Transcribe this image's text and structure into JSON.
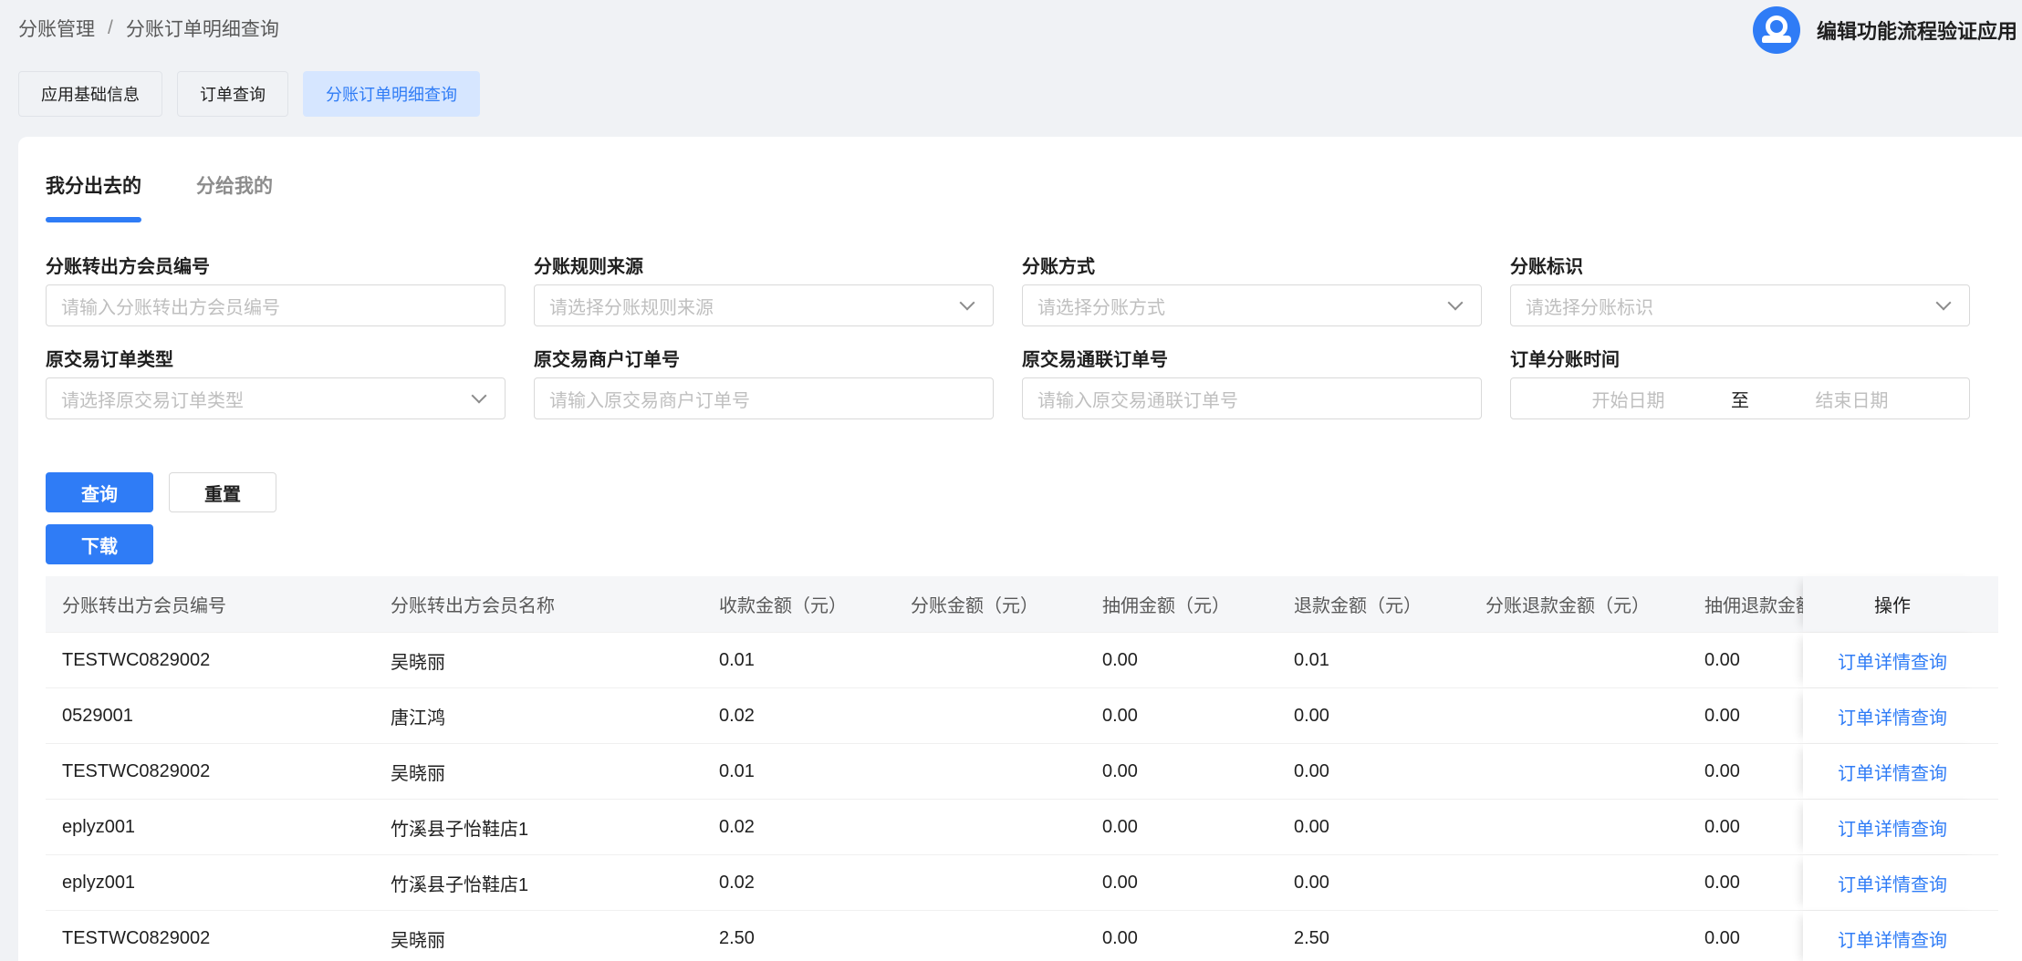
{
  "breadcrumb": {
    "root": "分账管理",
    "separator": "/",
    "current": "分账订单明细查询"
  },
  "user": {
    "name": "编辑功能流程验证应用"
  },
  "top_tabs": [
    {
      "label": "应用基础信息"
    },
    {
      "label": "订单查询"
    },
    {
      "label": "分账订单明细查询"
    }
  ],
  "sub_tabs": [
    {
      "label": "我分出去的"
    },
    {
      "label": "分给我的"
    }
  ],
  "filters": {
    "member_no": {
      "label": "分账转出方会员编号",
      "placeholder": "请输入分账转出方会员编号"
    },
    "rule_source": {
      "label": "分账规则来源",
      "placeholder": "请选择分账规则来源"
    },
    "method": {
      "label": "分账方式",
      "placeholder": "请选择分账方式"
    },
    "flag": {
      "label": "分账标识",
      "placeholder": "请选择分账标识"
    },
    "order_type": {
      "label": "原交易订单类型",
      "placeholder": "请选择原交易订单类型"
    },
    "merchant_order": {
      "label": "原交易商户订单号",
      "placeholder": "请输入原交易商户订单号"
    },
    "union_order": {
      "label": "原交易通联订单号",
      "placeholder": "请输入原交易通联订单号"
    },
    "time": {
      "label": "订单分账时间",
      "start_placeholder": "开始日期",
      "to": "至",
      "end_placeholder": "结束日期"
    }
  },
  "buttons": {
    "query": "查询",
    "reset": "重置",
    "download": "下载"
  },
  "table": {
    "headers": [
      "分账转出方会员编号",
      "分账转出方会员名称",
      "收款金额（元）",
      "分账金额（元）",
      "抽佣金额（元）",
      "退款金额（元）",
      "分账退款金额（元）",
      "抽佣退款金额",
      "操作"
    ],
    "rows": [
      {
        "member_no": "TESTWC0829002",
        "member_name": "吴晓丽",
        "receive": "0.01",
        "split": "",
        "commission": "0.00",
        "refund": "0.01",
        "split_refund": "",
        "commission_refund": "0.00",
        "action": "订单详情查询"
      },
      {
        "member_no": "0529001",
        "member_name": "唐江鸿",
        "receive": "0.02",
        "split": "",
        "commission": "0.00",
        "refund": "0.00",
        "split_refund": "",
        "commission_refund": "0.00",
        "action": "订单详情查询"
      },
      {
        "member_no": "TESTWC0829002",
        "member_name": "吴晓丽",
        "receive": "0.01",
        "split": "",
        "commission": "0.00",
        "refund": "0.00",
        "split_refund": "",
        "commission_refund": "0.00",
        "action": "订单详情查询"
      },
      {
        "member_no": "eplyz001",
        "member_name": "竹溪县子怡鞋店1",
        "receive": "0.02",
        "split": "",
        "commission": "0.00",
        "refund": "0.00",
        "split_refund": "",
        "commission_refund": "0.00",
        "action": "订单详情查询"
      },
      {
        "member_no": "eplyz001",
        "member_name": "竹溪县子怡鞋店1",
        "receive": "0.02",
        "split": "",
        "commission": "0.00",
        "refund": "0.00",
        "split_refund": "",
        "commission_refund": "0.00",
        "action": "订单详情查询"
      },
      {
        "member_no": "TESTWC0829002",
        "member_name": "吴晓丽",
        "receive": "2.50",
        "split": "",
        "commission": "0.00",
        "refund": "2.50",
        "split_refund": "",
        "commission_refund": "0.00",
        "action": "订单详情查询"
      }
    ]
  },
  "colors": {
    "accent": "#2f7cf6",
    "background": "#f0f2f5"
  }
}
